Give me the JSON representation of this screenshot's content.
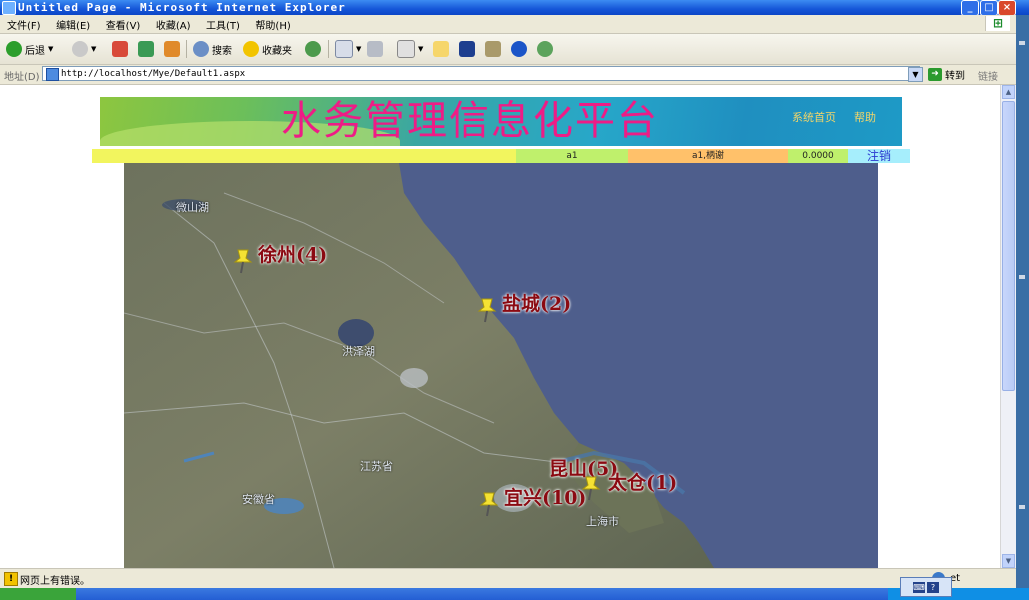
{
  "window": {
    "title": "Untitled Page - Microsoft Internet Explorer"
  },
  "menu": [
    "文件(F)",
    "编辑(E)",
    "查看(V)",
    "收藏(A)",
    "工具(T)",
    "帮助(H)"
  ],
  "toolbar": {
    "back": "后退",
    "search": "搜索",
    "favorites": "收藏夹"
  },
  "address": {
    "label": "地址(D)",
    "url": "http://localhost/Mye/Default1.aspx",
    "go": "转到",
    "links": "链接"
  },
  "banner": {
    "title": "水务管理信息化平台",
    "link1": "系统首页",
    "link2": "帮助"
  },
  "infobar": {
    "user": "a1",
    "role": "a1,柄谢",
    "value": "0.0000",
    "logout": "注销"
  },
  "map": {
    "markers": [
      {
        "label": "徐州(4)"
      },
      {
        "label": "盐城(2)"
      },
      {
        "label": "昆山(5)"
      },
      {
        "label": "太仓(1)"
      },
      {
        "label": "宜兴(10)"
      }
    ],
    "places": [
      "微山湖",
      "洪泽湖",
      "江苏省",
      "安徽省",
      "上海市"
    ]
  },
  "status": {
    "text": "网页上有错误。",
    "zone": "et"
  }
}
